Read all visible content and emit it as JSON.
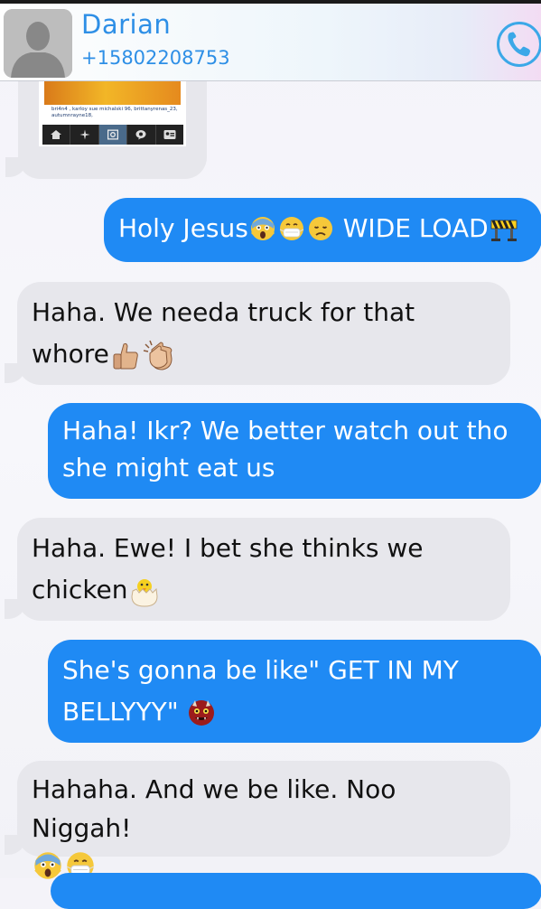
{
  "contact": {
    "name": "Darian",
    "number": "+15802208753"
  },
  "shared_image": {
    "caption": "bri4n4 , karloy sue michalski 96, brittanyrenas_23, autumnrayne18,"
  },
  "messages": [
    {
      "direction": "outgoing",
      "text": "Holy Jesus",
      "emoji_after": [
        "screaming-face-icon",
        "mask-face-icon",
        "disappointed-face-icon"
      ],
      "text2": " WIDE LOAD",
      "emoji_end": [
        "construction-icon"
      ]
    },
    {
      "direction": "incoming",
      "line1": "Haha. We needa truck for that",
      "line2": "whore",
      "emoji_after": [
        "thumbs-up-icon",
        "clapping-hands-icon"
      ]
    },
    {
      "direction": "outgoing",
      "line1": "Haha! Ikr? We better watch out tho",
      "line2": "she might eat us"
    },
    {
      "direction": "incoming",
      "line1": "Haha. Ewe! I bet she thinks we",
      "line2": "chicken",
      "emoji_after": [
        "hatching-chick-icon"
      ]
    },
    {
      "direction": "outgoing",
      "line1": "She's gonna be like\" GET IN MY",
      "line2": "BELLYYY\"",
      "emoji_after": [
        "ogre-icon"
      ]
    },
    {
      "direction": "incoming",
      "line1": "Hahaha. And we be like. Noo Niggah!",
      "emoji_line2": [
        "screaming-face-icon",
        "mask-face-icon"
      ]
    }
  ],
  "colors": {
    "accent": "#2e8fe6",
    "outgoing_bubble": "#1f8af4",
    "incoming_bubble": "#e7e7ec"
  }
}
